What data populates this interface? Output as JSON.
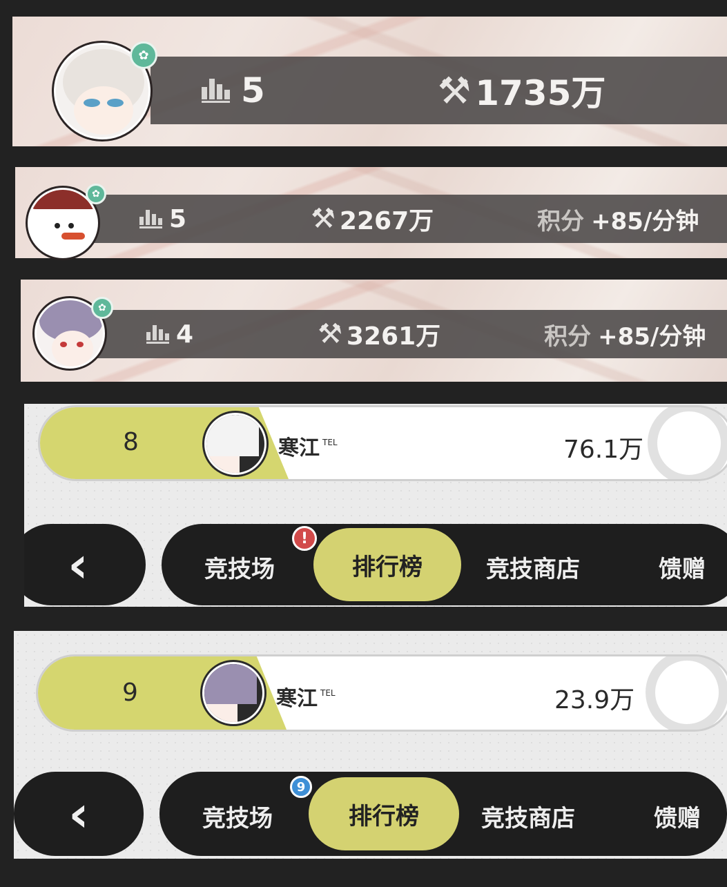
{
  "cards": [
    {
      "rank": "5",
      "power": "1735万"
    },
    {
      "rank": "5",
      "power": "2267万",
      "score_label": "积分",
      "score_value": "+85/分钟"
    },
    {
      "rank": "4",
      "power": "3261万",
      "score_label": "积分",
      "score_value": "+85/分钟"
    }
  ],
  "icons": {
    "tool": "⚒",
    "back": "‹",
    "alert": "!"
  },
  "leaderboard": [
    {
      "row": {
        "rank": "8",
        "name": "寒江",
        "tag": "TEL",
        "score": "76.1万"
      },
      "nav": {
        "back_icon": "‹",
        "items": [
          "竞技场",
          "排行榜",
          "竞技商店",
          "馈赠"
        ],
        "active": "排行榜",
        "badge_type": "alert",
        "badge_text": "!"
      }
    },
    {
      "row": {
        "rank": "9",
        "name": "寒江",
        "tag": "TEL",
        "score": "23.9万"
      },
      "nav": {
        "back_icon": "‹",
        "items": [
          "竞技场",
          "排行榜",
          "竞技商店",
          "馈赠"
        ],
        "active": "排行榜",
        "badge_type": "count",
        "badge_text": "9"
      }
    }
  ],
  "colors": {
    "accent_yellow": "#d5d66f",
    "badge_green": "#5fb89a",
    "alert_red": "#d24a4a",
    "count_blue": "#3e8fd6"
  }
}
